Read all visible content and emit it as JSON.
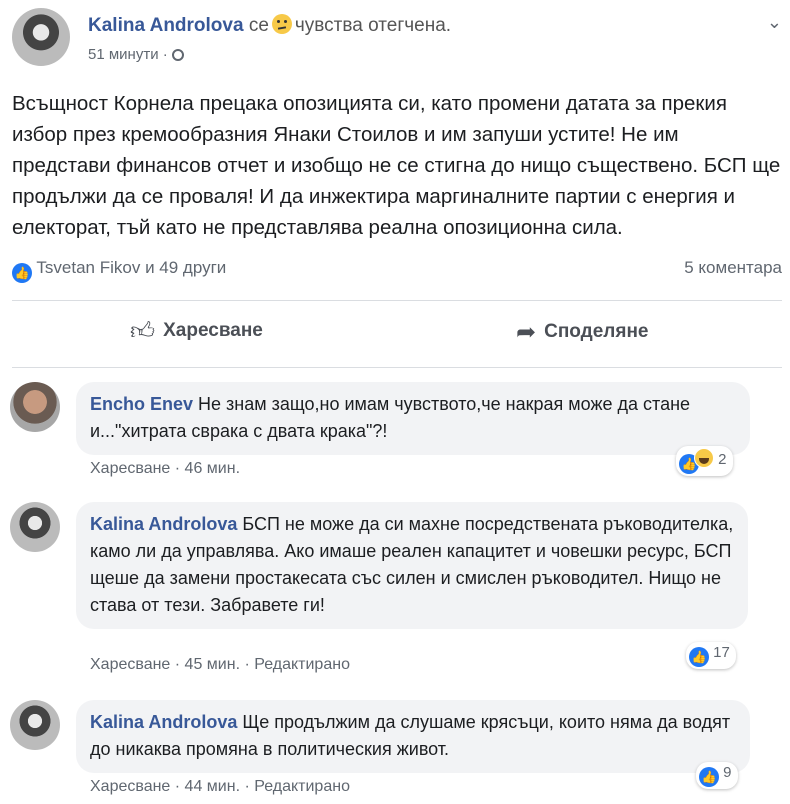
{
  "post": {
    "author": "Kalina Androlova",
    "feeling_prefix": "се",
    "feeling": "чувства отегчена.",
    "time": "51 минути",
    "text": "Всъщност Корнела прецака опозицията си, като промени датата за прекия избор през кремообразния Янаки Стоилов и им запуши устите! Не им представи финансов отчет и изобщо не се стигна до нищо съществено. БСП ще продължи да се проваля! И да инжектира маргиналните партии с енергия и електорат, тъй като не представлява реална опозиционна сила.",
    "reactions": "Tsvetan Fikov и 49 други",
    "comment_count": "5 коментара",
    "like_action": "Харесване",
    "share_action": "Споделяне"
  },
  "comments": [
    {
      "author": "Encho Enev",
      "text": "Не знам защо,но имам чувството,че накрая може да стане и...\"хитрата сврака с двата крака\"?!",
      "like_label": "Харесване",
      "time": "46 мин.",
      "edited": "",
      "reaction_count": "2"
    },
    {
      "author": "Kalina Androlova",
      "text": "БСП не може да си махне посредствената ръководителка, камо ли да управлява. Ако имаше реален капацитет и човешки ресурс, БСП щеше да замени простакесата със силен и смислен ръководител. Нищо не става от тези. Забравете ги!",
      "like_label": "Харесване",
      "time": "45 мин.",
      "edited": "Редактирано",
      "reaction_count": "17"
    },
    {
      "author": "Kalina Androlova",
      "text": "Ще продължим да слушаме крясъци, които няма да водят до никаква промяна в политическия живот.",
      "like_label": "Харесване",
      "time": "44 мин.",
      "edited": "Редактирано",
      "reaction_count": "9"
    }
  ]
}
